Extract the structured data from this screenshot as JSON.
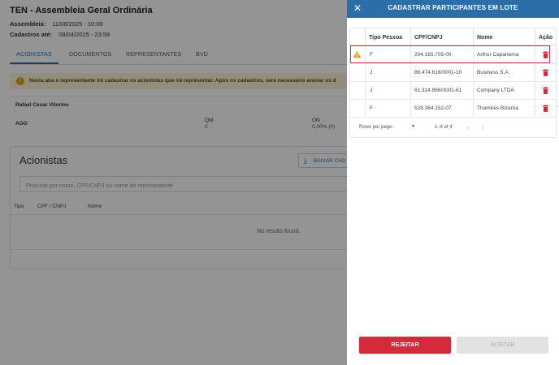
{
  "page": {
    "title": "TEN - Assembleia Geral Ordinária",
    "assembleia_label": "Assembleia:",
    "assembleia_value": "11/06/2025 - 10:00",
    "cadastros_label": "Cadastros até:",
    "cadastros_value": "08/04/2025 - 23:59",
    "tabs": [
      {
        "label": "ACIONISTAS",
        "active": true
      },
      {
        "label": "DOCUMENTOS",
        "active": false
      },
      {
        "label": "REPRESENTANTES",
        "active": false
      },
      {
        "label": "BVD",
        "active": false
      }
    ],
    "alert_text": "Nesta aba o representante irá cadastrar os acionistas que irá representar. Após os cadastros, será necessário anexar os d",
    "representative": {
      "name": "Rafael Cesar Vitorino",
      "kind": "AGO",
      "qtd_label": "Qtd",
      "qtd_value": "0",
      "on_label": "ON",
      "on_value": "0,00% (0)"
    },
    "acionistas": {
      "title": "Acionistas",
      "download_label": "BAIXAR CAD",
      "search_placeholder": "Procurar por nome, CPF/CNPJ ou nome do representante",
      "columns": [
        "Tipo",
        "CPF / CNPJ",
        "Nome"
      ],
      "empty_text": "No results found."
    }
  },
  "drawer": {
    "title": "CADASTRAR PARTICIPANTES EM LOTE",
    "close_icon": "close-icon",
    "columns": {
      "tipo": "Tipo Pessoa",
      "doc": "CPF/CNPJ",
      "nome": "Nome",
      "acao": "Ação"
    },
    "rows": [
      {
        "tipo": "F",
        "doc": "204.165.705-00",
        "nome": "Arthur Capanema",
        "warning": true
      },
      {
        "tipo": "J",
        "doc": "86.474.616/0001-10",
        "nome": "Business S.A",
        "warning": false
      },
      {
        "tipo": "J",
        "doc": "61.314.866/0001-61",
        "nome": "Company LTDA",
        "warning": false
      },
      {
        "tipo": "F",
        "doc": "528.364.152-07",
        "nome": "Thamires Bizarria",
        "warning": false
      }
    ],
    "pagination": {
      "rows_per_page_label": "Rows per page:",
      "range": "1–4 of 4"
    },
    "reject_label": "REJEITAR",
    "accept_label": "ACEITAR",
    "colors": {
      "header": "#2c6fa8",
      "reject": "#d42a3e",
      "delete_icon": "#d42a3e",
      "warning_icon": "#e8a13a",
      "highlight": "#c8334a"
    }
  }
}
